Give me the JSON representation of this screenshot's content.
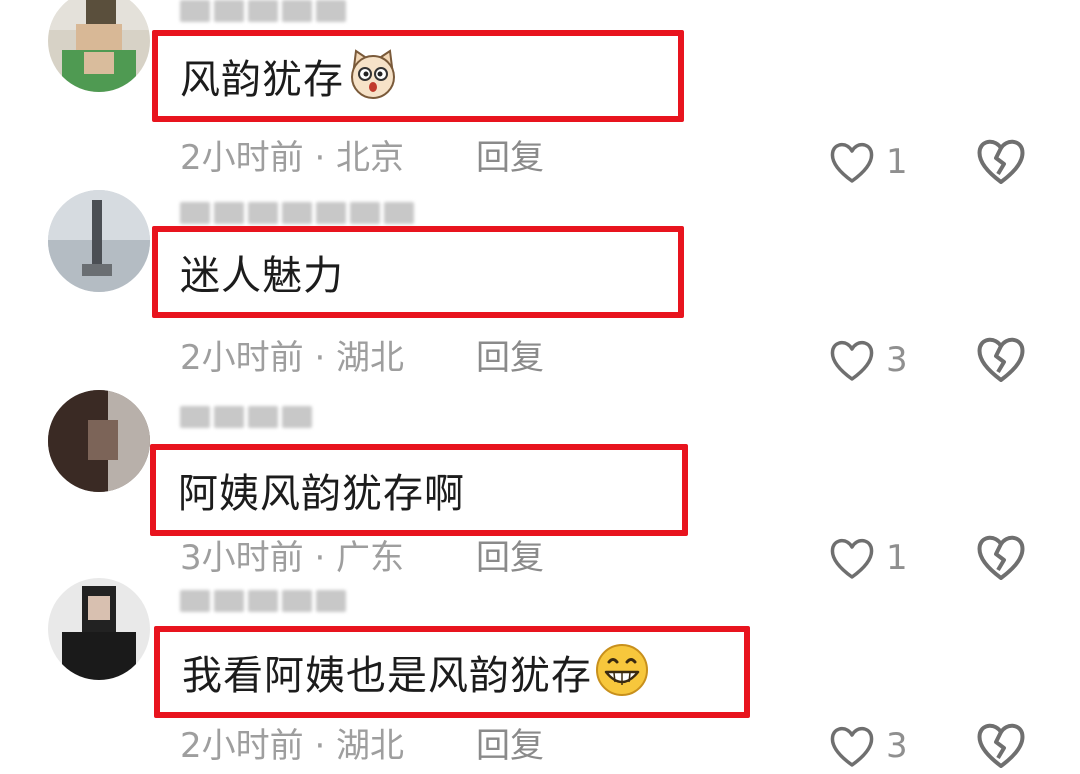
{
  "reply_label": "回复",
  "icons": {
    "like": "heart-outline-icon",
    "dislike": "broken-heart-icon",
    "emoji_1": "surprised-cat-emoji",
    "emoji_4": "grinning-face-emoji"
  },
  "colors": {
    "highlight_border": "#e8141e",
    "meta_text": "#9e9e9e",
    "icon_stroke": "#6f6f6f"
  },
  "comments": [
    {
      "text": "风韵犹存",
      "time_location": "2小时前 · 北京",
      "likes": "1"
    },
    {
      "text": "迷人魅力",
      "time_location": "2小时前 · 湖北",
      "likes": "3"
    },
    {
      "text": "阿姨风韵犹存啊",
      "time_location": "3小时前 · 广东",
      "likes": "1"
    },
    {
      "text": "我看阿姨也是风韵犹存",
      "time_location": "2小时前 · 湖北",
      "likes": "3"
    }
  ]
}
